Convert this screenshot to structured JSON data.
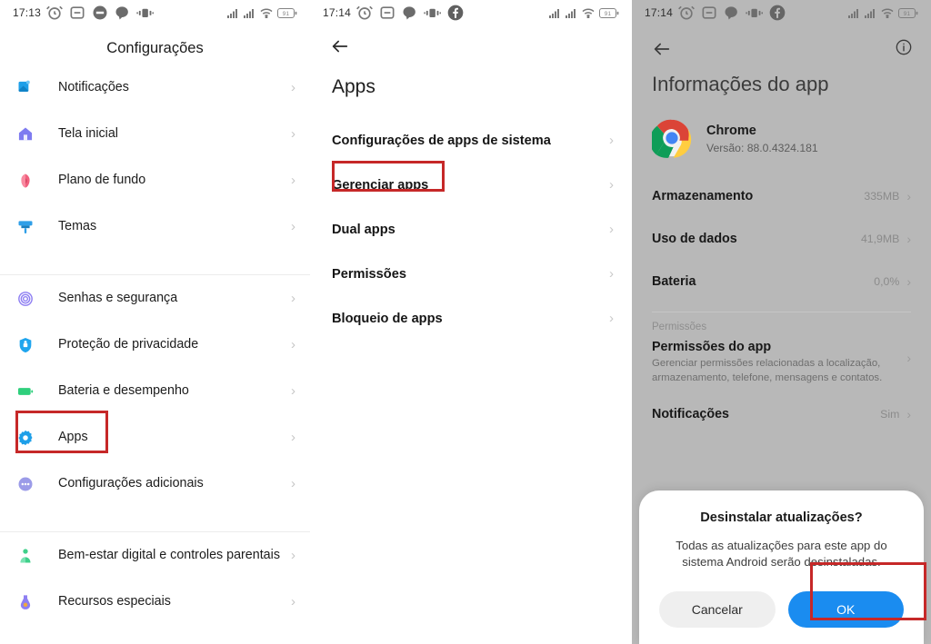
{
  "panel_settings": {
    "statusbar": {
      "time": "17:13",
      "left_icons": [
        "alarm-icon",
        "dnd-icon",
        "message-icon",
        "chat-icon",
        "vibrate-icon"
      ],
      "right_icons": [
        "signal-1-icon",
        "signal-2-icon",
        "wifi-icon"
      ],
      "battery": "91"
    },
    "title": "Configurações",
    "groups": [
      {
        "items": [
          {
            "label": "Notificações",
            "icon": "notifications-icon",
            "color": "#1e9fe8"
          },
          {
            "label": "Tela inicial",
            "icon": "home-icon",
            "color": "#7e7bf0"
          },
          {
            "label": "Plano de fundo",
            "icon": "wallpaper-flower-icon",
            "color": "#f0607e"
          },
          {
            "label": "Temas",
            "icon": "themes-brush-icon",
            "color": "#2f9fe8"
          }
        ]
      },
      {
        "items": [
          {
            "label": "Senhas e segurança",
            "icon": "fingerprint-icon",
            "color": "#8e7ff2"
          },
          {
            "label": "Proteção de privacidade",
            "icon": "privacy-shield-icon",
            "color": "#1fa5ee"
          },
          {
            "label": "Bateria e desempenho",
            "icon": "battery-icon",
            "color": "#2fcf7c"
          },
          {
            "label": "Apps",
            "icon": "apps-gear-icon",
            "color": "#1e9fe8",
            "highlighted": true
          },
          {
            "label": "Configurações adicionais",
            "icon": "additional-settings-icon",
            "color": "#9b9be8"
          }
        ]
      },
      {
        "items": [
          {
            "label": "Bem-estar digital e controles parentais",
            "icon": "digital-wellbeing-icon",
            "color": "#3fd08a"
          },
          {
            "label": "Recursos especiais",
            "icon": "special-features-icon",
            "color": "#8e7ff2"
          }
        ]
      }
    ],
    "chevron": "›"
  },
  "panel_apps": {
    "statusbar": {
      "time": "17:14",
      "battery": "91"
    },
    "back_label": "back-arrow",
    "title": "Apps",
    "items": [
      {
        "label": "Configurações de apps de sistema"
      },
      {
        "label": "Gerenciar apps",
        "highlighted": true
      },
      {
        "label": "Dual apps"
      },
      {
        "label": "Permissões"
      },
      {
        "label": "Bloqueio de apps"
      }
    ],
    "chevron": "›"
  },
  "panel_appinfo": {
    "statusbar": {
      "time": "17:14",
      "battery": "91"
    },
    "title": "Informações do app",
    "app": {
      "name": "Chrome",
      "version": "Versão: 88.0.4324.181",
      "icon": "chrome-icon"
    },
    "rows": [
      {
        "label": "Armazenamento",
        "value": "335MB"
      },
      {
        "label": "Uso de dados",
        "value": "41,9MB"
      },
      {
        "label": "Bateria",
        "value": "0,0%"
      }
    ],
    "section_label": "Permissões",
    "permissions_row": {
      "title": "Permissões do app",
      "subtitle": "Gerenciar permissões relacionadas a localização, armazenamento, telefone, mensagens e contatos."
    },
    "notifications_row": {
      "label": "Notificações",
      "value": "Sim"
    },
    "chevron": "›",
    "dialog": {
      "title": "Desinstalar atualizações?",
      "body": "Todas as atualizações para este app do sistema Android serão desinstaladas.",
      "cancel_label": "Cancelar",
      "ok_label": "OK",
      "ok_color": "#1a8cf0",
      "highlighted_button": "ok"
    }
  },
  "annotation": {
    "box_color": "#c62828"
  }
}
